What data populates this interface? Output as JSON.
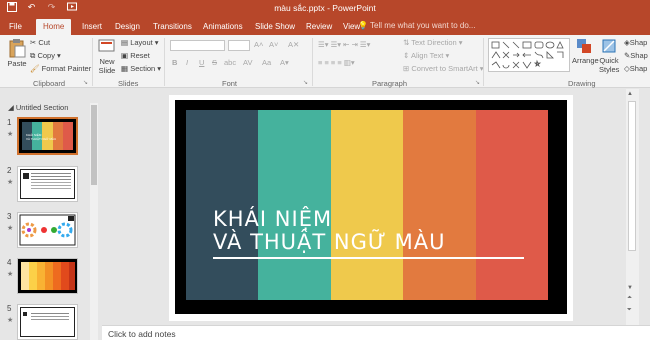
{
  "window": {
    "title": "màu sắc.pptx - PowerPoint"
  },
  "quick_access": [
    {
      "icon": "save-icon"
    },
    {
      "icon": "undo-icon"
    },
    {
      "icon": "redo-icon"
    },
    {
      "icon": "start-slideshow-icon"
    }
  ],
  "tabs": [
    "File",
    "Home",
    "Insert",
    "Design",
    "Transitions",
    "Animations",
    "Slide Show",
    "Review",
    "View"
  ],
  "tell_me": "Tell me what you want to do...",
  "ribbon": {
    "clipboard": {
      "paste": "Paste",
      "cut": "Cut",
      "copy": "Copy",
      "format_painter": "Format Painter",
      "label": "Clipboard"
    },
    "slides": {
      "new_slide_1": "New",
      "new_slide_2": "Slide",
      "layout": "Layout",
      "reset": "Reset",
      "section": "Section",
      "label": "Slides"
    },
    "font": {
      "bold": "B",
      "italic": "I",
      "underline": "U",
      "strike": "S",
      "shadow": "abc",
      "spacing": "AV",
      "case": "Aa",
      "label": "Font"
    },
    "paragraph": {
      "text_direction": "Text Direction",
      "align_text": "Align Text",
      "convert_smartart": "Convert to SmartArt",
      "label": "Paragraph"
    },
    "drawing": {
      "arrange": "Arrange",
      "quick_styles_1": "Quick",
      "quick_styles_2": "Styles",
      "shape_1": "Shap",
      "shape_2": "Shap",
      "shape_3": "Shap",
      "label": "Drawing"
    }
  },
  "thumbnails": {
    "section": "Untitled Section",
    "slides": [
      {
        "num": "1",
        "star": "★"
      },
      {
        "num": "2",
        "star": "★"
      },
      {
        "num": "3",
        "star": "★"
      },
      {
        "num": "4",
        "star": "★"
      },
      {
        "num": "5",
        "star": "★"
      }
    ],
    "slide1_line1": "KHÁI NIỆM",
    "slide1_line2": "VÀ THUẬT NGỮ MÀU"
  },
  "slide": {
    "title_line1": "KHÁI NIỆM",
    "title_line2": "VÀ THUẬT NGỮ MÀU",
    "stripe_colors": [
      "#334d5c",
      "#45b29d",
      "#efc94c",
      "#e27a3f",
      "#df5a49"
    ]
  },
  "notes": {
    "placeholder": "Click to add notes"
  },
  "colors": {
    "accent": "#b7472a",
    "selection": "#d0712d"
  }
}
